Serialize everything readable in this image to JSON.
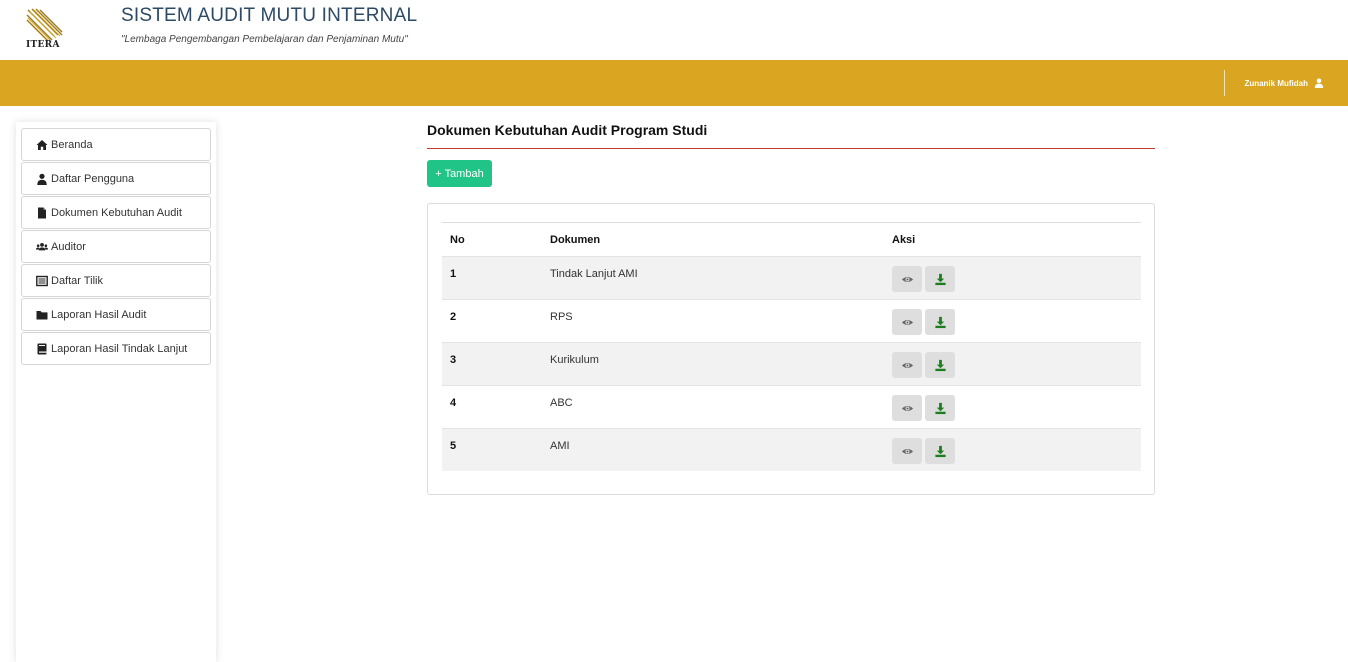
{
  "header": {
    "logo_text": "ITERA",
    "title": "SISTEM AUDIT MUTU INTERNAL",
    "subtitle": "\"Lembaga Pengembangan Pembelajaran dan Penjaminan Mutu\""
  },
  "topbar": {
    "user_name": "Zunanik Mufidah",
    "accent_color": "#daa520"
  },
  "sidebar": {
    "items": [
      {
        "label": "Beranda",
        "icon": "home-icon"
      },
      {
        "label": "Daftar Pengguna",
        "icon": "user-icon"
      },
      {
        "label": "Dokumen Kebutuhan Audit",
        "icon": "file-icon"
      },
      {
        "label": "Auditor",
        "icon": "users-icon"
      },
      {
        "label": "Daftar Tilik",
        "icon": "list-icon"
      },
      {
        "label": "Laporan Hasil Audit",
        "icon": "folder-icon"
      },
      {
        "label": "Laporan Hasil Tindak Lanjut",
        "icon": "book-icon"
      }
    ]
  },
  "main": {
    "title": "Dokumen Kebutuhan Audit Program Studi",
    "add_label": "+ Tambah",
    "table": {
      "headers": [
        "No",
        "Dokumen",
        "Aksi"
      ],
      "rows": [
        {
          "no": "1",
          "dokumen": "Tindak Lanjut AMI"
        },
        {
          "no": "2",
          "dokumen": "RPS"
        },
        {
          "no": "3",
          "dokumen": "Kurikulum"
        },
        {
          "no": "4",
          "dokumen": "ABC"
        },
        {
          "no": "5",
          "dokumen": "AMI"
        }
      ],
      "action_icons": [
        "eye-icon",
        "download-icon"
      ]
    }
  }
}
